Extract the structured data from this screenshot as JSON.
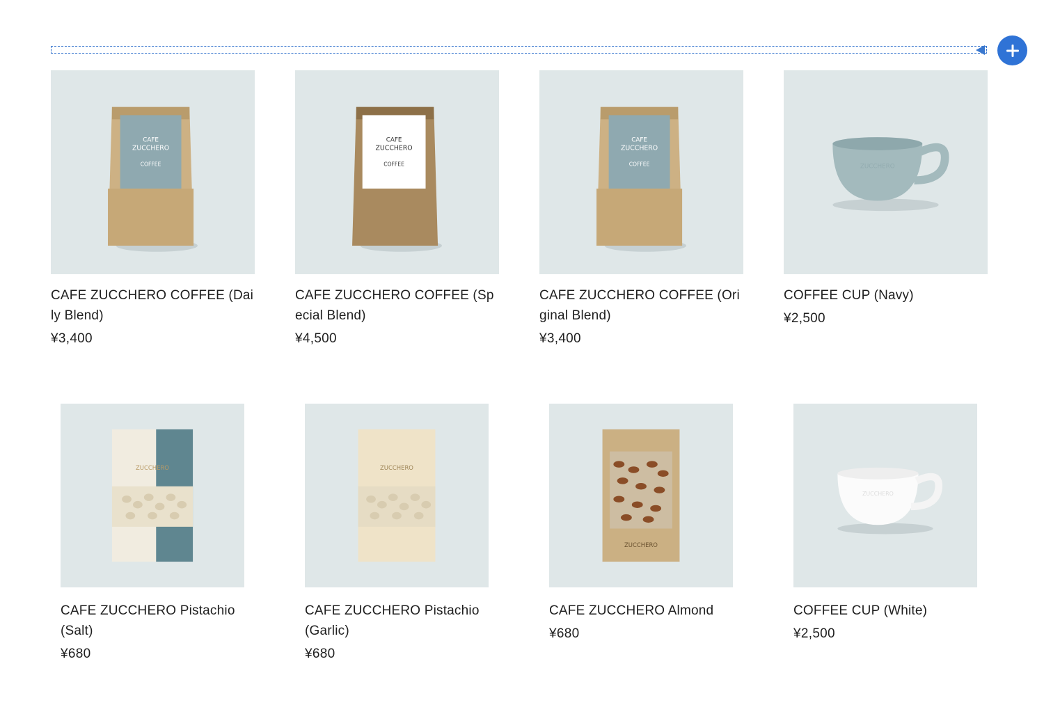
{
  "toolbar": {
    "add_button_icon": "plus-icon"
  },
  "products": [
    {
      "name": "CAFE ZUCCHERO COFFEE (Daily Blend)",
      "price": "¥3,400",
      "image": "kraft-coffee-bag-blue-label"
    },
    {
      "name": "CAFE ZUCCHERO COFFEE (Special Blend)",
      "price": "¥4,500",
      "image": "dark-kraft-coffee-bag-white-label"
    },
    {
      "name": "CAFE ZUCCHERO COFFEE (Original Blend)",
      "price": "¥3,400",
      "image": "kraft-coffee-bag-blue-label"
    },
    {
      "name": "COFFEE CUP (Navy)",
      "price": "¥2,500",
      "image": "blue-coffee-cup"
    },
    {
      "name": "CAFE ZUCCHERO Pistachio (Salt)",
      "price": "¥680",
      "image": "pistachio-pouch-blue"
    },
    {
      "name": "CAFE ZUCCHERO Pistachio (Garlic)",
      "price": "¥680",
      "image": "pistachio-pouch-cream"
    },
    {
      "name": "CAFE ZUCCHERO Almond",
      "price": "¥680",
      "image": "almond-pouch"
    },
    {
      "name": "COFFEE CUP (White)",
      "price": "¥2,500",
      "image": "white-coffee-cup"
    }
  ],
  "colors": {
    "thumb_bg": "#dfe7e8",
    "accent": "#2f73d6",
    "label_blue": "#8fa9b0",
    "kraft": "#c9ab7c"
  }
}
